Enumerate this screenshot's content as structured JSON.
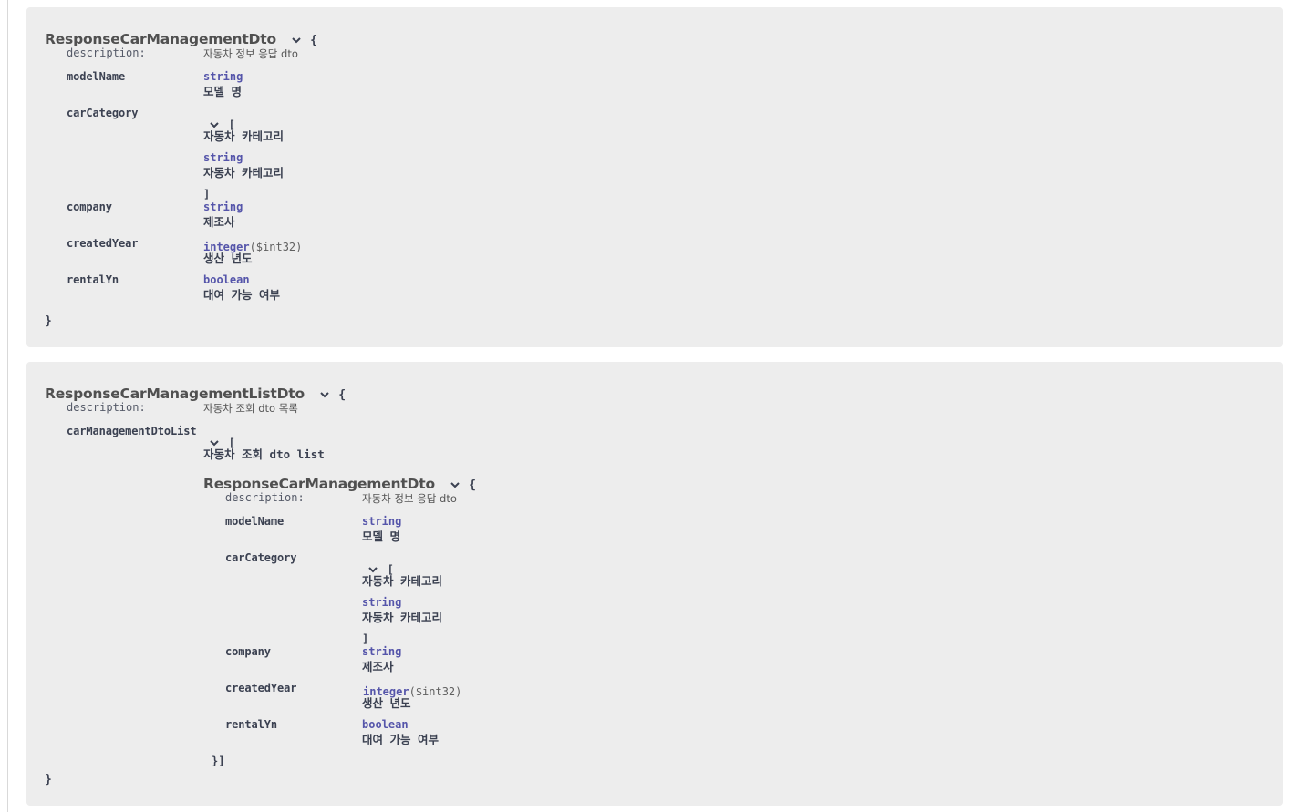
{
  "models": [
    {
      "title": "ResponseCarManagementDto",
      "open_brace": "{",
      "close_brace": "}",
      "description_label": "description:",
      "description": "자동차 정보 응답 dto",
      "properties": {
        "modelName": {
          "name": "modelName",
          "type": "string",
          "desc": "모델 명"
        },
        "carCategory": {
          "name": "carCategory",
          "array_open": "[",
          "array_desc": "자동차 카테고리",
          "item_type": "string",
          "item_desc": "자동차 카테고리",
          "array_close": "]"
        },
        "company": {
          "name": "company",
          "type": "string",
          "desc": "제조사"
        },
        "createdYear": {
          "name": "createdYear",
          "type": "integer",
          "format": "($int32)",
          "desc": "생산 년도"
        },
        "rentalYn": {
          "name": "rentalYn",
          "type": "boolean",
          "desc": "대여 가능 여부"
        }
      }
    },
    {
      "title": "ResponseCarManagementListDto",
      "open_brace": "{",
      "close_brace": "}",
      "description_label": "description:",
      "description": "자동차 조회 dto 목록",
      "properties": {
        "carManagementDtoList": {
          "name": "carManagementDtoList",
          "array_open": "[",
          "array_desc": "자동차 조회 dto list",
          "array_close": "}]",
          "item_model": {
            "title": "ResponseCarManagementDto",
            "open_brace": "{",
            "description_label": "description:",
            "description": "자동차 정보 응답 dto",
            "properties": {
              "modelName": {
                "name": "modelName",
                "type": "string",
                "desc": "모델 명"
              },
              "carCategory": {
                "name": "carCategory",
                "array_open": "[",
                "array_desc": "자동차 카테고리",
                "item_type": "string",
                "item_desc": "자동차 카테고리",
                "array_close": "]"
              },
              "company": {
                "name": "company",
                "type": "string",
                "desc": "제조사"
              },
              "createdYear": {
                "name": "createdYear",
                "type": "integer",
                "format": "($int32)",
                "desc": "생산 년도"
              },
              "rentalYn": {
                "name": "rentalYn",
                "type": "boolean",
                "desc": "대여 가능 여부"
              }
            }
          }
        }
      }
    }
  ],
  "icons": {
    "toggle": "chevron-down-icon"
  },
  "colors": {
    "box_background": "#ededed",
    "type_color": "#5555aa",
    "text_color": "#3b4151"
  }
}
